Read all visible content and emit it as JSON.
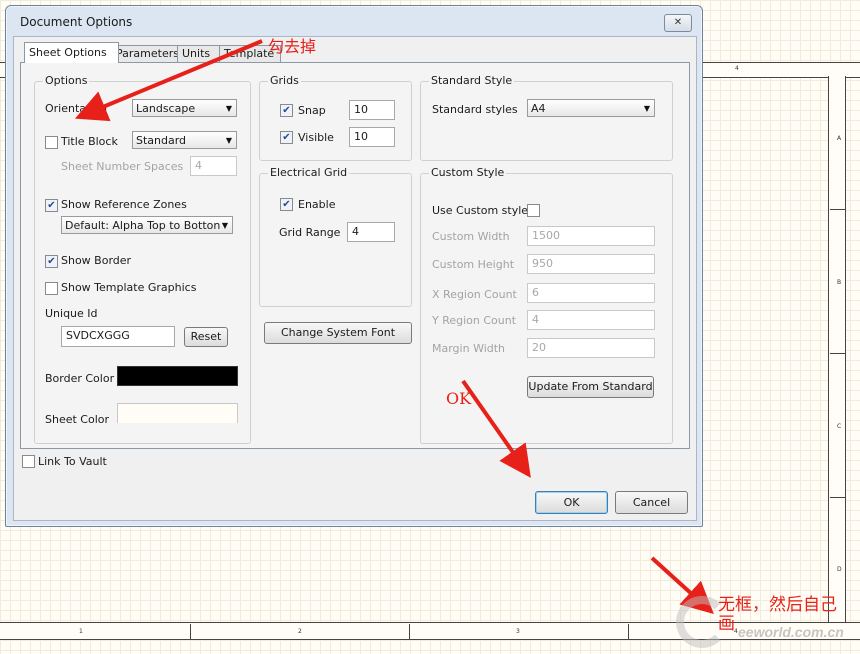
{
  "dialog": {
    "title": "Document Options",
    "close_glyph": "✕",
    "tabs": [
      {
        "label": "Sheet Options",
        "active": true
      },
      {
        "label": "Parameters",
        "active": false
      },
      {
        "label": "Units",
        "active": false
      },
      {
        "label": "Template",
        "active": false
      }
    ],
    "options": {
      "group_title": "Options",
      "orientation_label": "Orientation",
      "orientation_value": "Landscape",
      "title_block": {
        "label": "Title Block",
        "checked": false,
        "value": "Standard"
      },
      "sheet_number_spaces": {
        "label": "Sheet Number Spaces",
        "value": "4"
      },
      "show_reference_zones": {
        "label": "Show Reference Zones",
        "checked": true
      },
      "reference_zone_style": "Default: Alpha Top to Botton",
      "show_border": {
        "label": "Show Border",
        "checked": true
      },
      "show_template_graphics": {
        "label": "Show Template Graphics",
        "checked": false
      },
      "unique_id_label": "Unique Id",
      "unique_id_value": "SVDCXGGG",
      "reset_label": "Reset",
      "border_color_label": "Border Color",
      "border_color": "#000000",
      "sheet_color_label": "Sheet Color",
      "sheet_color": "#fffdf6"
    },
    "grids": {
      "group_title": "Grids",
      "snap": {
        "label": "Snap",
        "checked": true,
        "value": "10"
      },
      "visible": {
        "label": "Visible",
        "checked": true,
        "value": "10"
      }
    },
    "electrical_grid": {
      "group_title": "Electrical Grid",
      "enable": {
        "label": "Enable",
        "checked": true
      },
      "grid_range_label": "Grid Range",
      "grid_range_value": "4"
    },
    "change_font_label": "Change System Font",
    "standard_style": {
      "group_title": "Standard Style",
      "label": "Standard styles",
      "value": "A4"
    },
    "custom_style": {
      "group_title": "Custom Style",
      "use_custom": {
        "label": "Use Custom style",
        "checked": false
      },
      "fields": [
        {
          "label": "Custom Width",
          "value": "1500"
        },
        {
          "label": "Custom Height",
          "value": "950"
        },
        {
          "label": "X Region Count",
          "value": "6"
        },
        {
          "label": "Y Region Count",
          "value": "4"
        },
        {
          "label": "Margin Width",
          "value": "20"
        }
      ],
      "update_label": "Update From Standard"
    },
    "link_to_vault": {
      "label": "Link To Vault",
      "checked": false
    },
    "ok_label": "OK",
    "cancel_label": "Cancel"
  },
  "annotations": {
    "uncheck_note": "勾去掉",
    "ok_note": "OK",
    "no_frame_note_line1": "无框，然后自己",
    "no_frame_note_line2": "画",
    "arrow_color": "#e8201a"
  },
  "sheet": {
    "top_zone": "4",
    "right_zones": [
      "A",
      "B",
      "C",
      "D"
    ],
    "bottom_zones": [
      "1",
      "2",
      "3",
      "4"
    ]
  },
  "watermark": {
    "text": "eeworld.com.cn"
  }
}
